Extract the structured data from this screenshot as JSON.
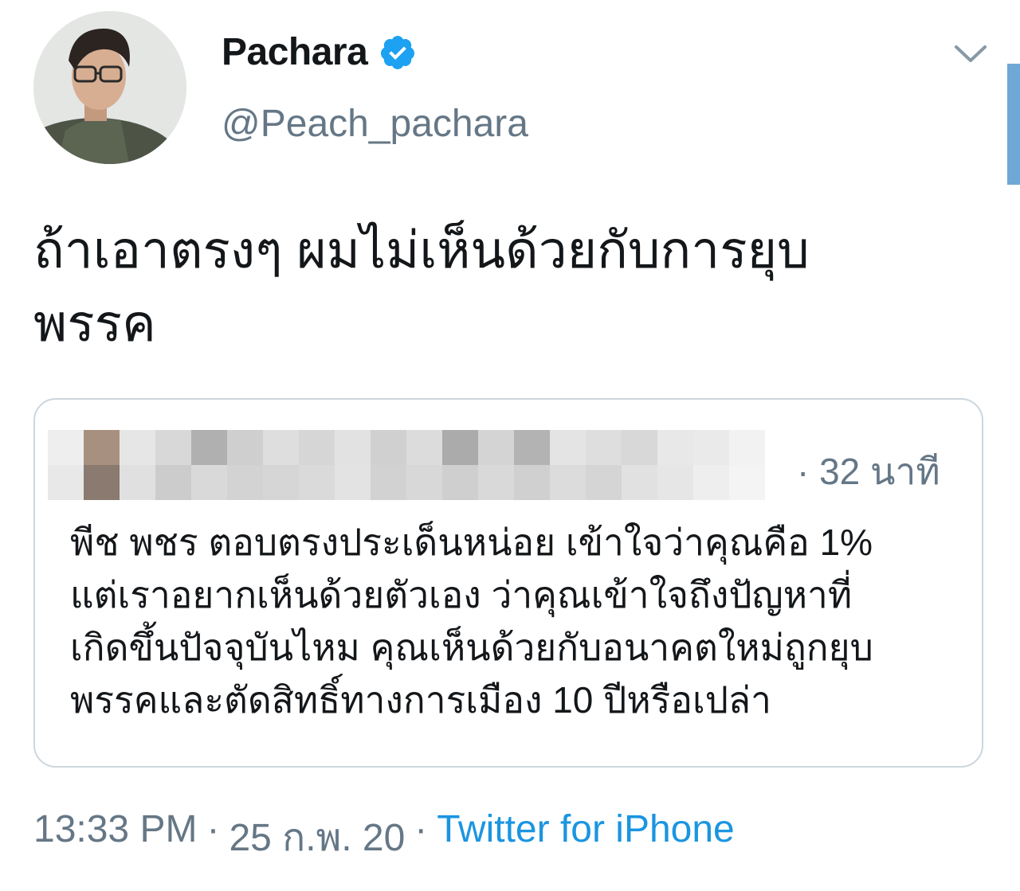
{
  "author": {
    "display_name": "Pachara",
    "handle": "@Peach_pachara",
    "verified": true,
    "verified_color": "#1da1f2"
  },
  "icons": {
    "verified": "verified-badge-icon",
    "more": "chevron-down-icon",
    "avatar": "profile-photo"
  },
  "tweet": {
    "text": "ถ้าเอาตรงๆ ผมไม่เห็นด้วยกับการยุบ\nพรรค"
  },
  "quoted_tweet": {
    "time": "· 32 นาที",
    "text": "พีช พชร ตอบตรงประเด็นหน่อย เข้าใจว่าคุณคือ 1%\nแต่เราอยากเห็นด้วยตัวเอง ว่าคุณเข้าใจถึงปัญหาที่\nเกิดขึ้นปัจจุบันไหม คุณเห็นด้วยกับอนาคตใหม่ถูกยุบ\nพรรคและตัดสิทธิ์ทางการเมือง 10 ปีหรือเปล่า"
  },
  "meta": {
    "time": "13:33 PM",
    "sep1": "·",
    "date": "25 ก.พ. 20",
    "sep2": "·",
    "source": "Twitter for iPhone"
  },
  "colors": {
    "text_primary": "#14171a",
    "text_secondary": "#657786",
    "link": "#1b95e0",
    "border": "#ccd6dd"
  }
}
